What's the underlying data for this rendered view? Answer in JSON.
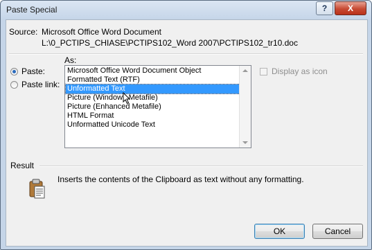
{
  "window": {
    "title": "Paste Special",
    "help_label": "?",
    "close_label": "X"
  },
  "source": {
    "label": "Source:",
    "value": "Microsoft Office Word Document",
    "path": "L:\\0_PCTIPS_CHIASE\\PCTIPS102_Word 2007\\PCTIPS102_tr10.doc"
  },
  "as_label": "As:",
  "options": {
    "paste_label": "Paste:",
    "paste_link_label": "Paste link:",
    "selected": "Paste"
  },
  "list": {
    "items": [
      "Microsoft Office Word Document Object",
      "Formatted Text (RTF)",
      "Unformatted Text",
      "Picture (Windows Metafile)",
      "Picture (Enhanced Metafile)",
      "HTML Format",
      "Unformatted Unicode Text"
    ],
    "selected_index": 2
  },
  "display_as_icon": {
    "label": "Display as icon",
    "checked": false,
    "enabled": false
  },
  "result": {
    "label": "Result",
    "description": "Inserts the contents of the Clipboard as text without any formatting."
  },
  "buttons": {
    "ok": "OK",
    "cancel": "Cancel"
  },
  "colors": {
    "selection": "#3399ff",
    "title_bar": "#c6d6e9",
    "close_button": "#c74a33"
  }
}
